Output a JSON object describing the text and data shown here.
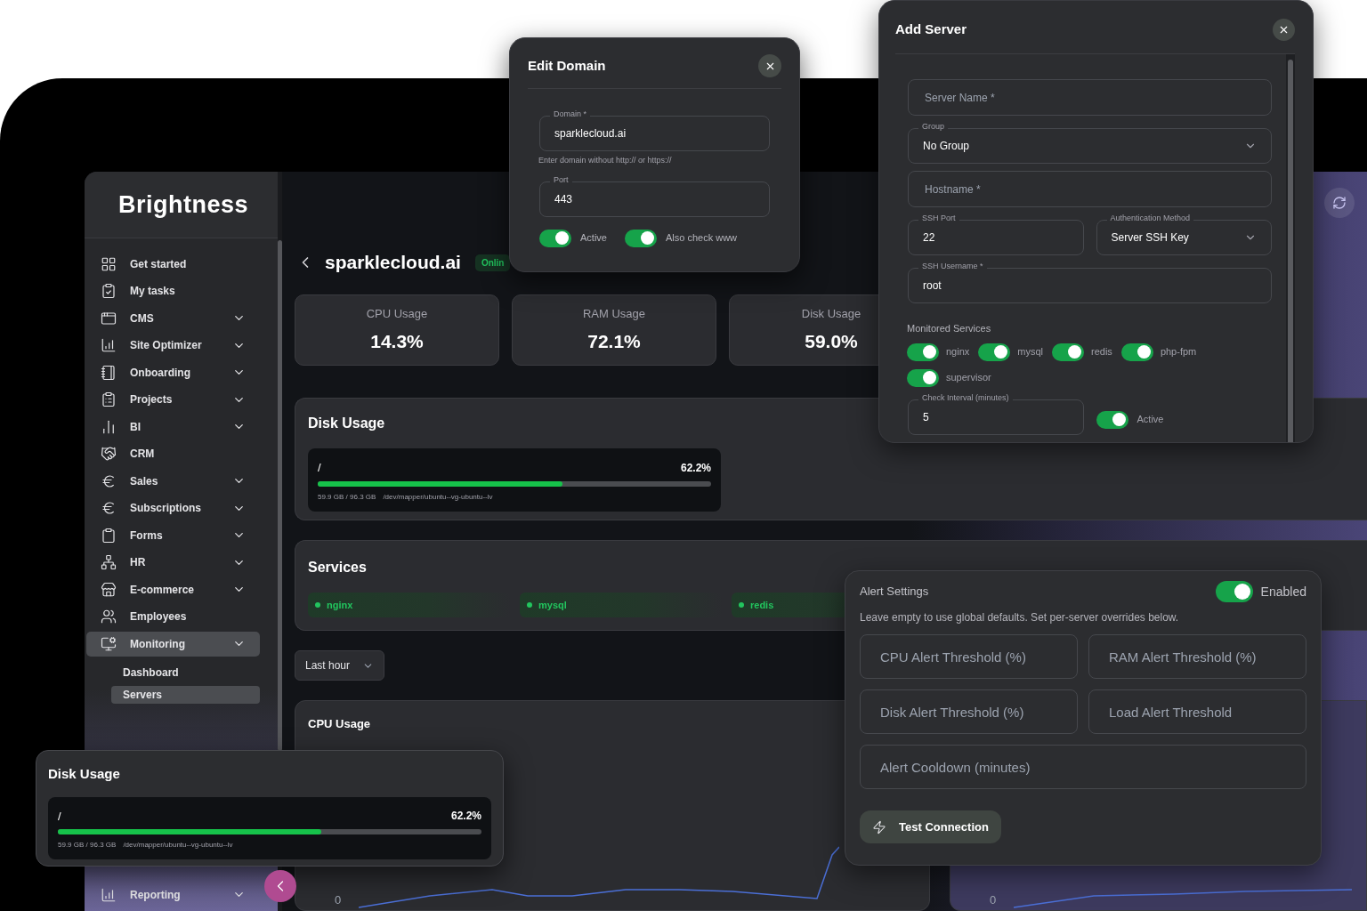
{
  "sidebar": {
    "logo": "Brightness",
    "items": [
      {
        "label": "Get started",
        "expandable": false,
        "selected": false
      },
      {
        "label": "My tasks",
        "expandable": false,
        "selected": false
      },
      {
        "label": "CMS",
        "expandable": true,
        "selected": false
      },
      {
        "label": "Site Optimizer",
        "expandable": true,
        "selected": false
      },
      {
        "label": "Onboarding",
        "expandable": true,
        "selected": false
      },
      {
        "label": "Projects",
        "expandable": true,
        "selected": false
      },
      {
        "label": "BI",
        "expandable": true,
        "selected": false
      },
      {
        "label": "CRM",
        "expandable": false,
        "selected": false
      },
      {
        "label": "Sales",
        "expandable": true,
        "selected": false
      },
      {
        "label": "Subscriptions",
        "expandable": true,
        "selected": false
      },
      {
        "label": "Forms",
        "expandable": true,
        "selected": false
      },
      {
        "label": "HR",
        "expandable": true,
        "selected": false
      },
      {
        "label": "E-commerce",
        "expandable": true,
        "selected": false
      },
      {
        "label": "Employees",
        "expandable": false,
        "selected": false
      },
      {
        "label": "Monitoring",
        "expandable": true,
        "selected": true,
        "children": [
          {
            "label": "Dashboard",
            "selected": false
          },
          {
            "label": "Servers",
            "selected": true
          }
        ]
      }
    ],
    "footer_items": [
      {
        "label": "Reporting",
        "expandable": true,
        "selected": false
      }
    ]
  },
  "page": {
    "title": "sparklecloud.ai",
    "status": "Onlin",
    "stats": [
      {
        "label": "CPU Usage",
        "value": "14.3%"
      },
      {
        "label": "RAM Usage",
        "value": "72.1%"
      },
      {
        "label": "Disk Usage",
        "value": "59.0%"
      }
    ],
    "disk_usage": {
      "title": "Disk Usage",
      "volumes": [
        {
          "mount": "/",
          "reading": "62.2%",
          "level": 0.622,
          "size": "59.9 GB / 96.3 GB",
          "device": "/dev/mapper/ubuntu--vg-ubuntu--lv"
        }
      ]
    },
    "services": {
      "title": "Services",
      "items": [
        {
          "name": "nginx",
          "color": "#22c55e"
        },
        {
          "name": "mysql",
          "color": "#22c55e"
        },
        {
          "name": "redis",
          "color": "#22c55e"
        }
      ]
    },
    "time_range": "Last hour",
    "charts": [
      {
        "title": "CPU Usage",
        "y_tick": "0"
      },
      {
        "y_tick": "0"
      }
    ]
  },
  "edit_domain": {
    "title": "Edit Domain",
    "fields": [
      {
        "kind": "text",
        "label": "Domain *",
        "value": "sparklecloud.ai",
        "hint": "Enter domain without http:// or https://"
      },
      {
        "kind": "text",
        "label": "Port",
        "value": "443"
      }
    ],
    "toggles": [
      {
        "label": "Active",
        "on": true
      },
      {
        "label": "Also check www",
        "on": true
      }
    ]
  },
  "add_server": {
    "title": "Add Server",
    "rows": [
      [
        {
          "kind": "text",
          "placeholder": "Server Name *"
        }
      ],
      [
        {
          "kind": "select",
          "label": "Group",
          "value": "No Group"
        }
      ],
      [
        {
          "kind": "text",
          "placeholder": "Hostname *"
        }
      ],
      [
        {
          "kind": "text",
          "label": "SSH Port",
          "value": "22"
        },
        {
          "kind": "select",
          "label": "Authentication Method",
          "value": "Server SSH Key"
        }
      ],
      [
        {
          "kind": "text",
          "label": "SSH Username *",
          "value": "root"
        }
      ]
    ],
    "services_title": "Monitored Services",
    "services": [
      {
        "label": "nginx",
        "on": true
      },
      {
        "label": "mysql",
        "on": true
      },
      {
        "label": "redis",
        "on": true
      },
      {
        "label": "php-fpm",
        "on": true
      },
      {
        "label": "supervisor",
        "on": true
      }
    ],
    "interval": {
      "kind": "text",
      "label": "Check Interval (minutes)",
      "value": "5"
    },
    "active": {
      "label": "Active",
      "on": true
    }
  },
  "alert_settings": {
    "title": "Alert Settings",
    "enabled": {
      "label": "Enabled",
      "on": true
    },
    "note": "Leave empty to use global defaults. Set per-server overrides below.",
    "rows": [
      [
        {
          "kind": "text",
          "placeholder": "CPU Alert Threshold (%)"
        },
        {
          "kind": "text",
          "placeholder": "RAM Alert Threshold (%)"
        }
      ],
      [
        {
          "kind": "text",
          "placeholder": "Disk Alert Threshold (%)"
        },
        {
          "kind": "text",
          "placeholder": "Load Alert Threshold"
        }
      ],
      [
        {
          "kind": "text",
          "placeholder": "Alert Cooldown (minutes)"
        }
      ]
    ],
    "button": "Test Connection"
  },
  "disk_popup": {
    "title": "Disk Usage",
    "volumes": [
      {
        "mount": "/",
        "reading": "62.2%",
        "level": 0.622,
        "size": "59.9 GB / 96.3 GB",
        "device": "/dev/mapper/ubuntu--vg-ubuntu--lv"
      }
    ]
  }
}
